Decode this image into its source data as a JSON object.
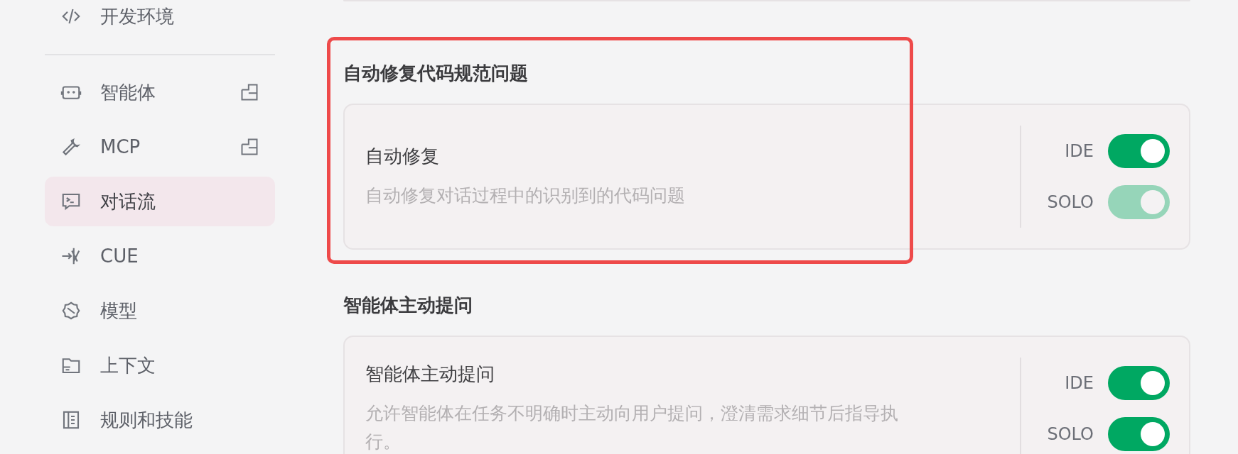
{
  "sidebar": {
    "top_items": [
      {
        "label": "开发环境",
        "selected": false
      }
    ],
    "items": [
      {
        "label": "智能体",
        "selected": false,
        "external": true
      },
      {
        "label": "MCP",
        "selected": false,
        "external": true
      },
      {
        "label": "对话流",
        "selected": true,
        "external": false
      },
      {
        "label": "CUE",
        "selected": false,
        "external": false
      },
      {
        "label": "模型",
        "selected": false,
        "external": false
      },
      {
        "label": "上下文",
        "selected": false,
        "external": false
      },
      {
        "label": "规则和技能",
        "selected": false,
        "external": false
      }
    ]
  },
  "sections": [
    {
      "title": "自动修复代码规范问题",
      "highlighted": true,
      "settings": [
        {
          "title": "自动修复",
          "description": "自动修复对话过程中的识别到的代码问题",
          "toggles": [
            {
              "label": "IDE",
              "on": true,
              "disabled": false
            },
            {
              "label": "SOLO",
              "on": true,
              "disabled": true
            }
          ]
        }
      ]
    },
    {
      "title": "智能体主动提问",
      "highlighted": false,
      "settings": [
        {
          "title": "智能体主动提问",
          "description": "允许智能体在任务不明确时主动向用户提问，澄清需求细节后指导执行。",
          "toggles": [
            {
              "label": "IDE",
              "on": true,
              "disabled": false
            },
            {
              "label": "SOLO",
              "on": true,
              "disabled": false
            }
          ]
        }
      ]
    }
  ]
}
